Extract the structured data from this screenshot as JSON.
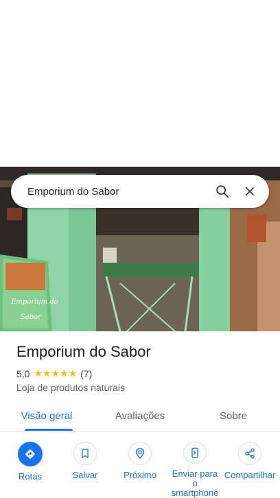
{
  "search": {
    "query": "Emporium do Sabor"
  },
  "photo": {
    "sign_text": "Emporium do Sabor"
  },
  "place": {
    "name": "Emporium do Sabor",
    "rating": "5,0",
    "stars": "★★★★★",
    "reviews": "(7)",
    "category": "Loja de produtos naturais"
  },
  "tabs": [
    {
      "label": "Visão geral"
    },
    {
      "label": "Avaliações"
    },
    {
      "label": "Sobre"
    }
  ],
  "actions": [
    {
      "label": "Rotas",
      "icon": "directions-icon"
    },
    {
      "label": "Salvar",
      "icon": "bookmark-icon"
    },
    {
      "label": "Próximo",
      "icon": "nearby-icon"
    },
    {
      "label": "Enviar para o smartphone",
      "icon": "send-to-phone-icon"
    },
    {
      "label": "Compartilhar",
      "icon": "share-icon"
    }
  ],
  "colors": {
    "accent": "#1a73e8",
    "star": "#fbbc04",
    "storefront_green": "#8fd3a6"
  }
}
